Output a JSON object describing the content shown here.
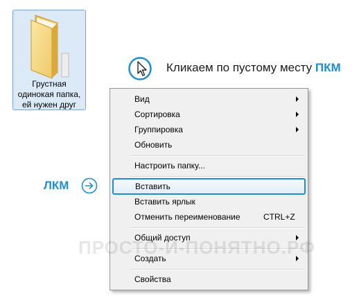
{
  "desktop": {
    "folder": {
      "icon": "folder-icon",
      "label_lines": [
        "Грустная",
        "одинокая папка,",
        "ей нужен друг"
      ]
    }
  },
  "hints": {
    "right_click": {
      "icon": "mouse-pointer-icon",
      "text": "Кликаем по пустому месту ",
      "accent": "ПКМ"
    },
    "left_click": {
      "label": "ЛКМ",
      "icon": "circle-arrow-right-icon"
    }
  },
  "context_menu": {
    "items": [
      {
        "label": "Вид",
        "submenu": true
      },
      {
        "label": "Сортировка",
        "submenu": true
      },
      {
        "label": "Группировка",
        "submenu": true
      },
      {
        "label": "Обновить",
        "submenu": false
      },
      {
        "label": "Настроить папку...",
        "submenu": false
      },
      {
        "label": "Вставить",
        "submenu": false,
        "highlighted": true
      },
      {
        "label": "Вставить ярлык",
        "submenu": false
      },
      {
        "label": "Отменить переименование",
        "shortcut": "CTRL+Z",
        "submenu": false
      },
      {
        "label": "Общий доступ",
        "submenu": true
      },
      {
        "label": "Создать",
        "submenu": true
      },
      {
        "label": "Свойства",
        "submenu": false
      }
    ]
  },
  "watermark": "ПРОСТО-И-ПОНЯТНО.РФ",
  "colors": {
    "accent": "#1e8ed0",
    "menu_background": "#f0f0f0",
    "folder_selection": "#dceaf8"
  }
}
